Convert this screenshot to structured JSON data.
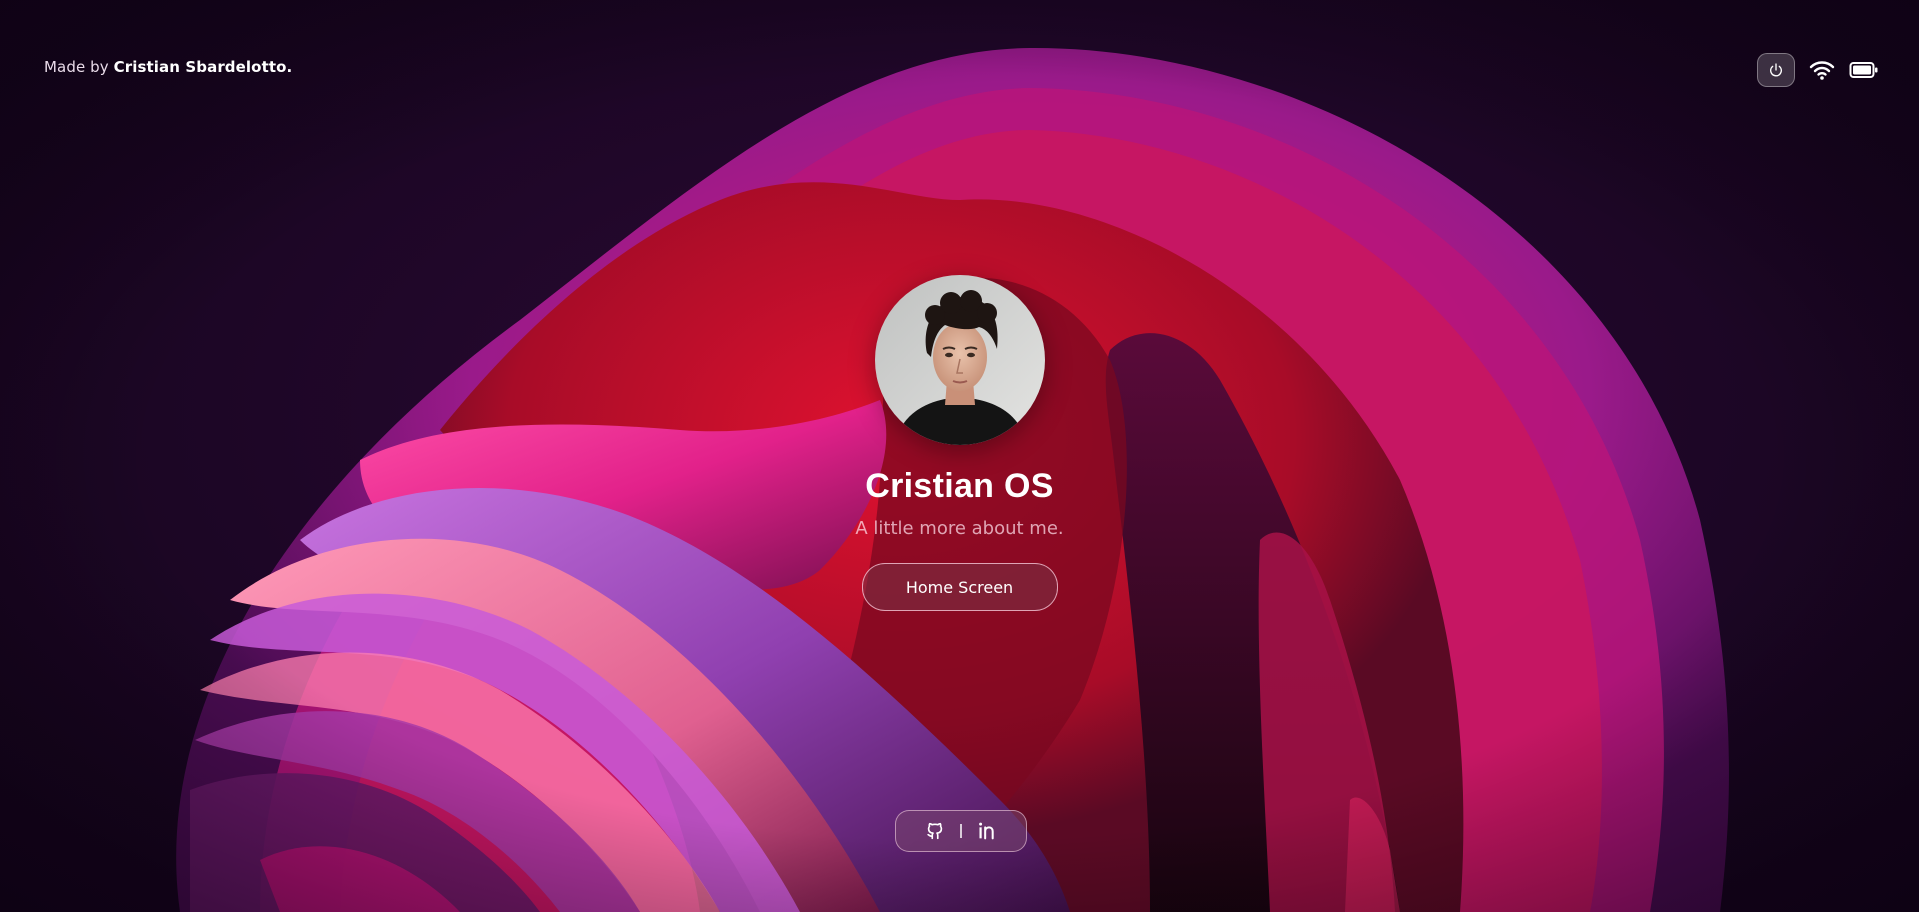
{
  "credit": {
    "prefix": "Made by",
    "name": "Cristian Sbardelotto."
  },
  "status_bar": {
    "icons": [
      "power-icon",
      "wifi-icon",
      "battery-icon"
    ]
  },
  "profile": {
    "title": "Cristian OS",
    "subtitle": "A little more about me.",
    "button_label": "Home Screen"
  },
  "social": {
    "icons": [
      "github-icon",
      "linkedin-icon"
    ]
  },
  "colors": {
    "background": "#1d0626",
    "accent_red": "#c8102e",
    "accent_pink": "#e0208a",
    "accent_purple": "#9a2cb0"
  }
}
